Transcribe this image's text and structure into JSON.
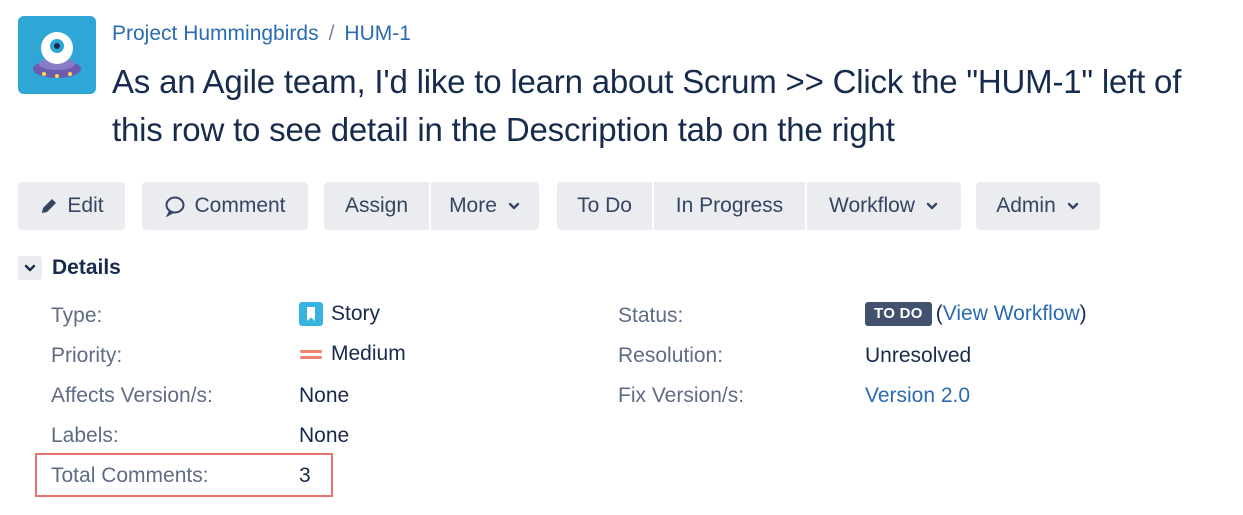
{
  "header": {
    "project_name": "Project Hummingbirds",
    "separator": "/",
    "issue_key": "HUM-1",
    "title": "As an Agile team, I'd like to learn about Scrum >> Click the \"HUM-1\" left of this row to see detail in the Description tab on the right"
  },
  "toolbar": {
    "edit_label": "Edit",
    "comment_label": "Comment",
    "assign_label": "Assign",
    "more_label": "More",
    "todo_label": "To Do",
    "in_progress_label": "In Progress",
    "workflow_label": "Workflow",
    "admin_label": "Admin"
  },
  "details": {
    "heading": "Details",
    "left": {
      "type_label": "Type:",
      "type_value": "Story",
      "priority_label": "Priority:",
      "priority_value": "Medium",
      "affects_label": "Affects Version/s:",
      "affects_value": "None",
      "labels_label": "Labels:",
      "labels_value": "None",
      "comments_label": "Total Comments:",
      "comments_value": "3"
    },
    "right": {
      "status_label": "Status:",
      "status_value": "TO DO",
      "view_workflow_open": "(",
      "view_workflow_link": "View Workflow",
      "view_workflow_close": ")",
      "resolution_label": "Resolution:",
      "resolution_value": "Unresolved",
      "fix_label": "Fix Version/s:",
      "fix_value": "Version 2.0"
    }
  },
  "icons": {
    "avatar": "hummingbird-robot-icon",
    "edit": "pencil-icon",
    "comment": "speech-bubble-icon",
    "chevron": "chevron-down-icon",
    "story": "bookmark-icon",
    "priority": "medium-priority-icon"
  },
  "colors": {
    "link": "#2a6bb3",
    "button_bg": "#ebecf0",
    "lozenge_bg": "#42526e",
    "highlight_border": "#e8736a",
    "story_icon": "#36b3de",
    "priority_icon": "#f0826e",
    "avatar_bg": "#2fa7d6"
  }
}
